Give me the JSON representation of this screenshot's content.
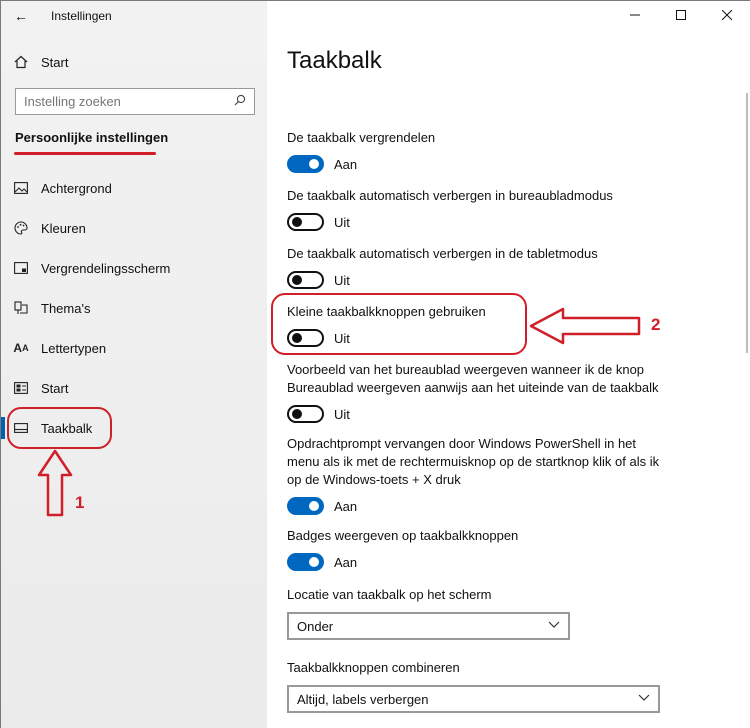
{
  "window": {
    "title": "Instellingen",
    "controls": [
      "minimize",
      "maximize",
      "close"
    ]
  },
  "sidebar": {
    "back_icon": "back-arrow-icon",
    "home_label": "Start",
    "search_placeholder": "Instelling zoeken",
    "section_heading": "Persoonlijke instellingen",
    "items": [
      {
        "label": "Achtergrond",
        "icon": "image-icon"
      },
      {
        "label": "Kleuren",
        "icon": "palette-icon"
      },
      {
        "label": "Vergrendelingsscherm",
        "icon": "lock-screen-icon"
      },
      {
        "label": "Thema's",
        "icon": "brush-icon"
      },
      {
        "label": "Lettertypen",
        "icon": "font-icon"
      },
      {
        "label": "Start",
        "icon": "start-icon"
      },
      {
        "label": "Taakbalk",
        "icon": "taskbar-icon",
        "active": true
      }
    ]
  },
  "main": {
    "title": "Taakbalk",
    "settings": [
      {
        "label": "De taakbalk vergrendelen",
        "state": "Aan",
        "on": true
      },
      {
        "label": "De taakbalk automatisch verbergen in bureaubladmodus",
        "state": "Uit",
        "on": false
      },
      {
        "label": "De taakbalk automatisch verbergen in de tabletmodus",
        "state": "Uit",
        "on": false
      },
      {
        "label": "Kleine taakbalkknoppen gebruiken",
        "state": "Uit",
        "on": false
      },
      {
        "label": "Voorbeeld van het bureaublad weergeven wanneer ik de knop Bureaublad weergeven aanwijs aan het uiteinde van de taakbalk",
        "state": "Uit",
        "on": false
      },
      {
        "label": "Opdrachtprompt vervangen door Windows PowerShell in het menu als ik met de rechtermuisknop op de startknop klik of als ik op de Windows-toets + X druk",
        "state": "Aan",
        "on": true
      },
      {
        "label": "Badges weergeven op taakbalkknoppen",
        "state": "Aan",
        "on": true
      }
    ],
    "location": {
      "label": "Locatie van taakbalk op het scherm",
      "value": "Onder"
    },
    "combine": {
      "label": "Taakbalkknoppen combineren",
      "value": "Altijd, labels verbergen"
    }
  },
  "annotations": {
    "number_1": "1",
    "number_2": "2",
    "color": "#d11f2a"
  },
  "colors": {
    "accent": "#0067c0",
    "annotation": "#d11f2a"
  }
}
